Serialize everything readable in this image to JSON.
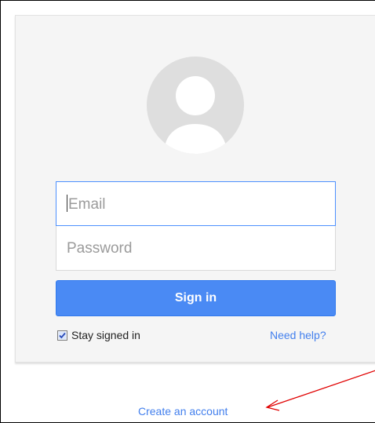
{
  "login": {
    "email_placeholder": "Email",
    "password_placeholder": "Password",
    "signin_label": "Sign in",
    "stay_signed_in_label": "Stay signed in",
    "stay_signed_in_checked": true,
    "need_help_label": "Need help?"
  },
  "footer": {
    "create_account_label": "Create an account"
  },
  "icons": {
    "avatar": "user-silhouette-icon",
    "annotation": "red-arrow-icon"
  },
  "colors": {
    "primary_button": "#4a8af4",
    "link": "#427fed",
    "focus_border": "#4d90fe",
    "card_background": "#f5f5f5",
    "annotation_arrow": "#e00000"
  }
}
